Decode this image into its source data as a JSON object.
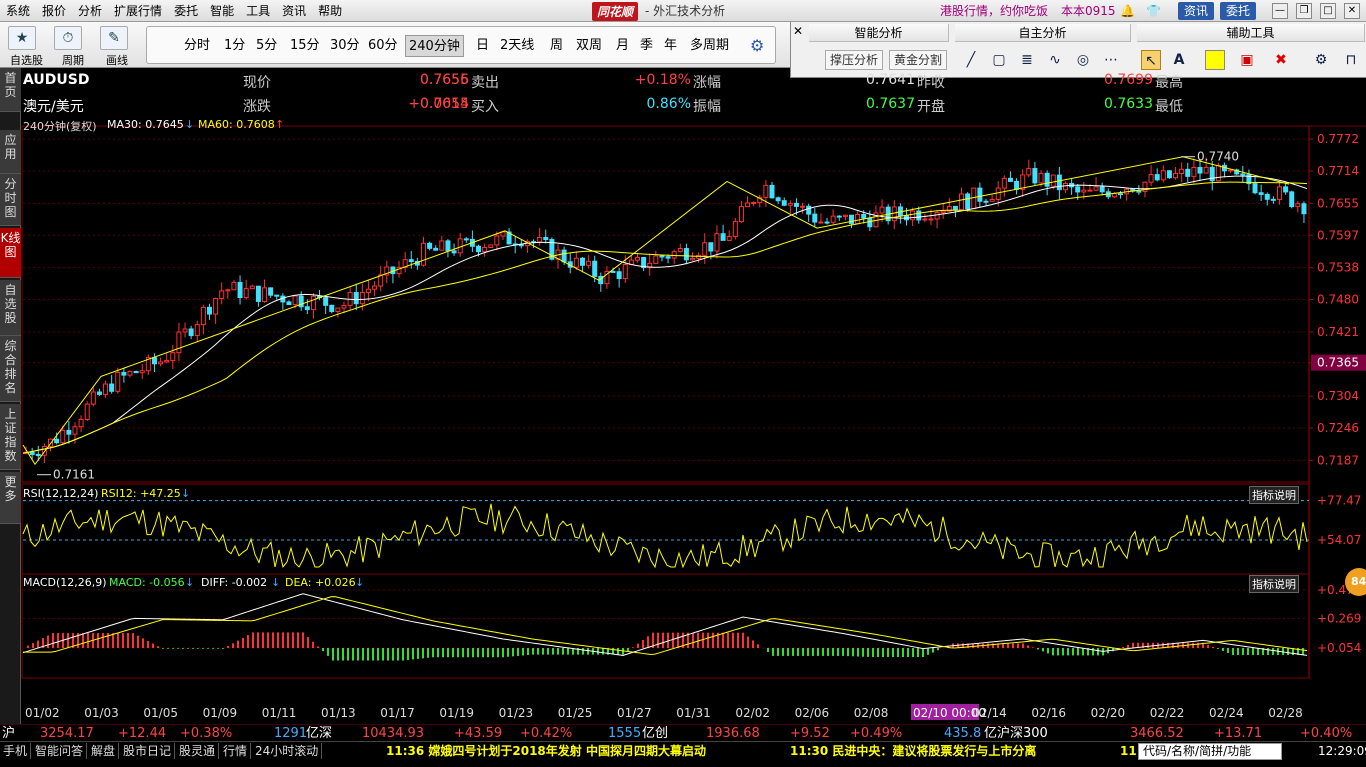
{
  "menu": {
    "items": [
      "系统",
      "报价",
      "分析",
      "扩展行情",
      "委托",
      "智能",
      "工具",
      "资讯",
      "帮助"
    ],
    "brand": "同花顺",
    "title": "- 外汇技术分析",
    "promo": "港股行情，约你吃饭",
    "version": "本本0915",
    "btn_news": "资讯",
    "btn_trade": "委托",
    "colors": {
      "news_btn": "#2a5aa8",
      "trade_btn": "#2a5aa8"
    }
  },
  "toolbar": {
    "selfselect_label": "自选股",
    "period_label": "周期",
    "draw_label": "画线",
    "periods": [
      "分时",
      "1分",
      "5分",
      "15分",
      "30分",
      "60分",
      "240分钟",
      "日",
      "2天线",
      "周",
      "双周",
      "月",
      "季",
      "年",
      "多周期"
    ],
    "active_period": "240分钟"
  },
  "rpanel": {
    "smart_title": "智能分析",
    "self_title": "自主分析",
    "assist_title": "辅助工具",
    "btn_support": "撑压分析",
    "btn_golden": "黄金分割"
  },
  "lefttabs": [
    "首页",
    "应用",
    "分时图",
    "K线图",
    "自选股",
    "综合排名",
    "上证指数",
    "更多"
  ],
  "quote": {
    "symbol": "AUDUSD",
    "name": "澳元/美元",
    "row1": [
      {
        "label": "现价",
        "value": "0.7655",
        "color": "#ff4040"
      },
      {
        "label": "卖出",
        "value": "0.7656",
        "color": "#ff4040"
      },
      {
        "label": "涨幅",
        "value": "+0.18%",
        "color": "#ff4040"
      },
      {
        "label": "昨收",
        "value": "0.7641",
        "color": "#dddddd"
      },
      {
        "label": "最高",
        "value": "0.7699",
        "color": "#ff4040"
      }
    ],
    "row2": [
      {
        "label": "涨跌",
        "value": "+0.0014",
        "color": "#ff4040"
      },
      {
        "label": "买入",
        "value": "0.7655",
        "color": "#ff4040"
      },
      {
        "label": "振幅",
        "value": "0.86%",
        "color": "#40e0ff"
      },
      {
        "label": "开盘",
        "value": "0.7637",
        "color": "#40ff40"
      },
      {
        "label": "最低",
        "value": "0.7633",
        "color": "#40ff40"
      }
    ]
  },
  "indicators": {
    "main_label": "240分钟(复权)",
    "ma30_label": "MA30: 0.7645",
    "ma60_label": "MA60: 0.7608",
    "rsi_label": "RSI(12,12,24)",
    "rsi12_label": "RSI12: +47.25",
    "macd_label": "MACD(12,26,9)",
    "macd_value": "MACD: -0.056",
    "diff_value": "DIFF: -0.002",
    "dea_value": "DEA: +0.026",
    "explain_btn": "指标说明",
    "badge": "84"
  },
  "chart_data": [
    {
      "type": "candlestick",
      "title": "AUDUSD 240分钟",
      "y_ticks": [
        "0.7772",
        "0.7714",
        "0.7655",
        "0.7597",
        "0.7538",
        "0.7480",
        "0.7421",
        "0.7365",
        "0.7304",
        "0.7246",
        "0.7187"
      ],
      "ylim": [
        0.7155,
        0.7785
      ],
      "current_price_tag": "0.7365",
      "annotations": [
        {
          "label": "0.7740",
          "value": 0.774
        },
        {
          "label": "0.7161",
          "value": 0.7161
        }
      ],
      "x_ticks": [
        "01/02",
        "01/03",
        "01/05",
        "01/09",
        "01/11",
        "01/13",
        "01/17",
        "01/19",
        "01/23",
        "01/25",
        "01/27",
        "01/31",
        "02/02",
        "02/06",
        "02/08",
        "02/10 00:00",
        "02/14",
        "02/16",
        "02/20",
        "02/22",
        "02/24",
        "02/28"
      ],
      "series": [
        {
          "name": "MA30",
          "values_start": 0.72,
          "values_end": 0.769
        },
        {
          "name": "MA60",
          "values_start": 0.72,
          "values_end": 0.7675
        }
      ]
    },
    {
      "type": "line",
      "title": "RSI(12,12,24)",
      "y_ticks": [
        "+77.47",
        "+54.07"
      ],
      "ylim": [
        35,
        85
      ],
      "series": [
        {
          "name": "RSI12"
        }
      ]
    },
    {
      "type": "bar",
      "title": "MACD(12,26,9)",
      "y_ticks": [
        "+0.478",
        "+0.269",
        "+0.054"
      ],
      "ylim": [
        -0.15,
        0.55
      ],
      "series": [
        {
          "name": "DIFF"
        },
        {
          "name": "DEA"
        },
        {
          "name": "MACD"
        }
      ]
    }
  ],
  "statusbar": {
    "sh_label": "沪",
    "sh_index": "3254.17",
    "sh_change": "+12.44",
    "sh_pct": "+0.38%",
    "sh_amount": "1291",
    "sz_label": "亿深",
    "sz_index": "10434.93",
    "sz_change": "+43.59",
    "sz_pct": "+0.42%",
    "cy_amount": "1555",
    "cy_label": "亿创",
    "cy_index": "1936.68",
    "cy_change": "+9.52",
    "cy_pct": "+0.49%",
    "hs_amount": "435.8",
    "hs_label": "亿沪深300",
    "hs_index": "3466.52",
    "hs_change": "+13.71",
    "hs_pct": "+0.40%"
  },
  "bottombar": {
    "tabs": [
      "手机",
      "智能问答",
      "解盘",
      "股市日记",
      "股灵通",
      "行情",
      "24小时滚动"
    ],
    "news1": "11:36 嫦娥四号计划于2018年发射 中国探月四期大幕启动",
    "news2": "11:30 民进中央：建议将股票发行与上市分离",
    "news3": "11",
    "code_placeholder": "代码/名称/简拼/功能",
    "time": "12:29:09"
  }
}
